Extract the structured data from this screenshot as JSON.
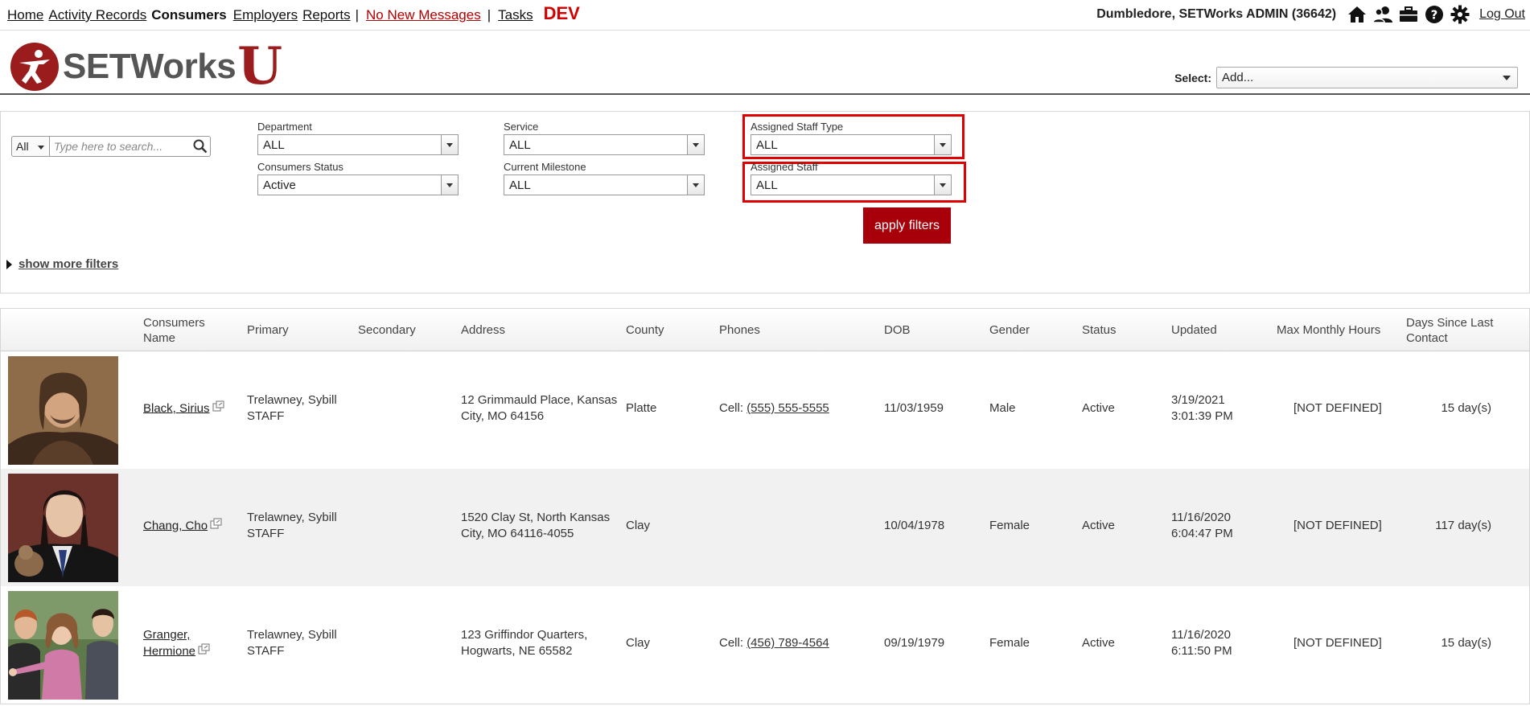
{
  "nav": {
    "links": [
      "Home",
      "Activity Records"
    ],
    "current": "Consumers",
    "links2": [
      "Employers",
      "Reports"
    ],
    "sep": "|",
    "messages": "No New Messages",
    "tasks": "Tasks",
    "env": "DEV",
    "user": "Dumbledore, SETWorks ADMIN  (36642)",
    "logout": "Log Out",
    "icons": [
      "home-icon",
      "users-icon",
      "briefcase-icon",
      "help-icon",
      "gear-icon"
    ]
  },
  "header": {
    "logo_word": "SETWorks",
    "logo_u": "U",
    "select_label": "Select:",
    "select_value": "Add..."
  },
  "filters": {
    "scope": "All",
    "search_placeholder": "Type here to search...",
    "department_label": "Department",
    "department_value": "ALL",
    "consumers_status_label": "Consumers Status",
    "consumers_status_value": "Active",
    "service_label": "Service",
    "service_value": "ALL",
    "milestone_label": "Current Milestone",
    "milestone_value": "ALL",
    "staff_type_label": "Assigned Staff Type",
    "staff_type_value": "ALL",
    "staff_label": "Assigned Staff",
    "staff_value": "ALL",
    "apply": "apply filters",
    "more": "show more filters"
  },
  "table": {
    "columns": {
      "name": "Consumers Name",
      "primary": "Primary",
      "secondary": "Secondary",
      "address": "Address",
      "county": "County",
      "phones": "Phones",
      "dob": "DOB",
      "gender": "Gender",
      "status": "Status",
      "updated": "Updated",
      "hours": "Max Monthly Hours",
      "days": "Days Since Last Contact"
    },
    "rows": [
      {
        "name": "Black, Sirius",
        "primary1": "Trelawney, Sybill",
        "primary2": "STAFF",
        "address": "12 Grimmauld Place, Kansas City, MO 64156",
        "county": "Platte",
        "phone_prefix": "Cell:",
        "phone": "(555) 555-5555",
        "dob": "11/03/1959",
        "gender": "Male",
        "status": "Active",
        "updated1": "3/19/2021",
        "updated2": "3:01:39 PM",
        "hours": "[NOT DEFINED]",
        "days": "15 day(s)"
      },
      {
        "name": "Chang, Cho",
        "primary1": "Trelawney, Sybill",
        "primary2": "STAFF",
        "address": "1520 Clay St, North Kansas City, MO 64116-4055",
        "county": "Clay",
        "phone_prefix": "",
        "phone": "",
        "dob": "10/04/1978",
        "gender": "Female",
        "status": "Active",
        "updated1": "11/16/2020",
        "updated2": "6:04:47 PM",
        "hours": "[NOT DEFINED]",
        "days": "117 day(s)"
      },
      {
        "name": "Granger, Hermione",
        "primary1": "Trelawney, Sybill",
        "primary2": "STAFF",
        "address": "123 Griffindor Quarters, Hogwarts, NE 65582",
        "county": "Clay",
        "phone_prefix": "Cell:",
        "phone": "(456) 789-4564",
        "dob": "09/19/1979",
        "gender": "Female",
        "status": "Active",
        "updated1": "11/16/2020",
        "updated2": "6:11:50 PM",
        "hours": "[NOT DEFINED]",
        "days": "15 day(s)"
      }
    ]
  }
}
